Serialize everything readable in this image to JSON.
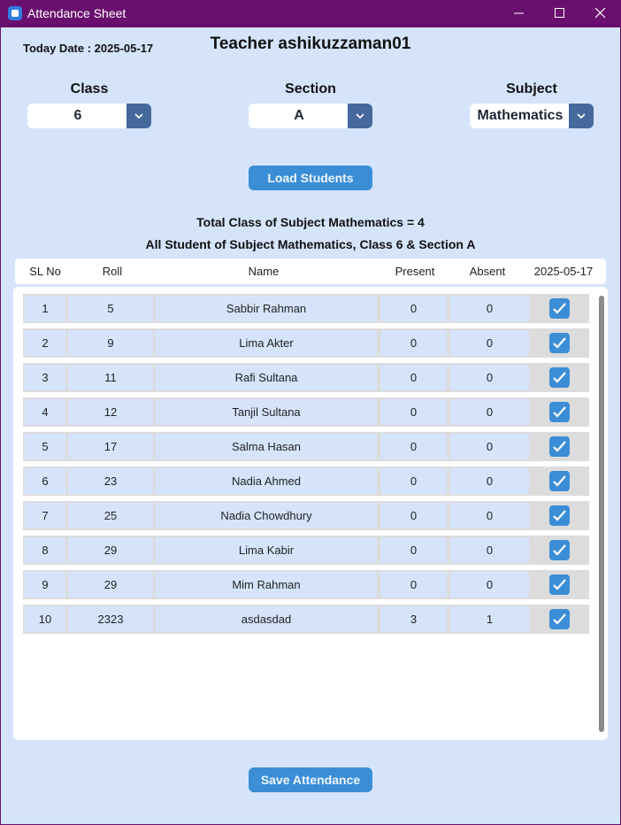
{
  "window": {
    "title": "Attendance Sheet",
    "accent": "#69106e"
  },
  "header": {
    "today_date": "Today Date : 2025-05-17",
    "teacher": "Teacher ashikuzzaman01"
  },
  "filters": {
    "class_label": "Class",
    "class_value": "6",
    "section_label": "Section",
    "section_value": "A",
    "subject_label": "Subject",
    "subject_value": "Mathematics"
  },
  "buttons": {
    "load_students": "Load Students",
    "save_attendance": "Save Attendance"
  },
  "summary": {
    "total_class": "Total Class of Subject Mathematics = 4",
    "all_students": "All Student of Subject Mathematics, Class 6 & Section A"
  },
  "table": {
    "columns": [
      "SL No",
      "Roll",
      "Name",
      "Present",
      "Absent",
      "2025-05-17"
    ],
    "rows": [
      {
        "sl": "1",
        "roll": "5",
        "name": "Sabbir Rahman",
        "present": "0",
        "absent": "0",
        "checked": true
      },
      {
        "sl": "2",
        "roll": "9",
        "name": "Lima Akter",
        "present": "0",
        "absent": "0",
        "checked": true
      },
      {
        "sl": "3",
        "roll": "11",
        "name": "Rafi Sultana",
        "present": "0",
        "absent": "0",
        "checked": true
      },
      {
        "sl": "4",
        "roll": "12",
        "name": "Tanjil Sultana",
        "present": "0",
        "absent": "0",
        "checked": true
      },
      {
        "sl": "5",
        "roll": "17",
        "name": "Salma Hasan",
        "present": "0",
        "absent": "0",
        "checked": true
      },
      {
        "sl": "6",
        "roll": "23",
        "name": "Nadia Ahmed",
        "present": "0",
        "absent": "0",
        "checked": true
      },
      {
        "sl": "7",
        "roll": "25",
        "name": "Nadia Chowdhury",
        "present": "0",
        "absent": "0",
        "checked": true
      },
      {
        "sl": "8",
        "roll": "29",
        "name": "Lima Kabir",
        "present": "0",
        "absent": "0",
        "checked": true
      },
      {
        "sl": "9",
        "roll": "29",
        "name": "Mim Rahman",
        "present": "0",
        "absent": "0",
        "checked": true
      },
      {
        "sl": "10",
        "roll": "2323",
        "name": "asdasdad",
        "present": "3",
        "absent": "1",
        "checked": true
      }
    ]
  }
}
